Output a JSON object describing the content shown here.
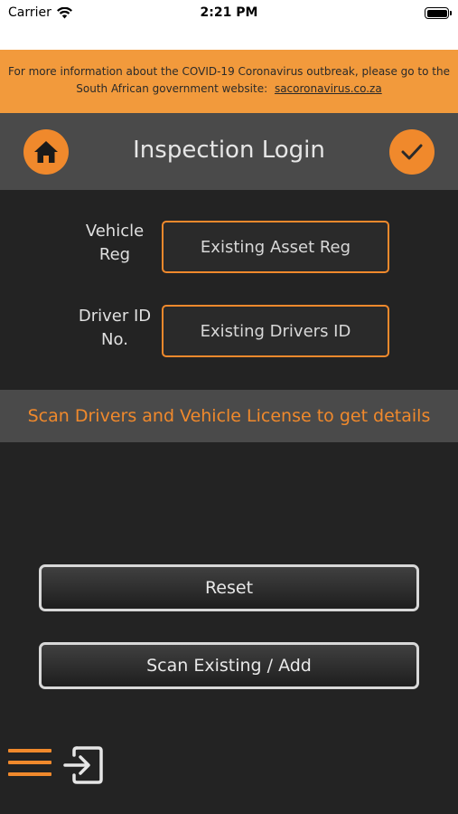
{
  "status_bar": {
    "carrier": "Carrier",
    "time": "2:21 PM"
  },
  "banner": {
    "text_line1": "For more information about the COVID-19 Coronavirus outbreak, please go to the",
    "text_line2": "South African government website:",
    "link": "sacoronavirus.co.za"
  },
  "header": {
    "title": "Inspection Login",
    "left_icon": "home-icon",
    "right_icon": "checkmark-icon"
  },
  "form": {
    "vehicle_label_line1": "Vehicle",
    "vehicle_label_line2": "Reg",
    "vehicle_placeholder": "Existing Asset Reg",
    "driver_label_line1": "Driver ID",
    "driver_label_line2": "No.",
    "driver_placeholder": "Existing Drivers ID"
  },
  "scan_strip": {
    "text": "Scan Drivers and Vehicle License to get details"
  },
  "buttons": {
    "reset": "Reset",
    "scan_add": "Scan Existing / Add"
  },
  "footer": {
    "menu_icon": "hamburger-menu-icon",
    "logout_icon": "logout-icon"
  },
  "colors": {
    "accent": "#F0892C",
    "banner": "#F29A3C",
    "background": "#232323",
    "bar": "#4a4a4a"
  }
}
